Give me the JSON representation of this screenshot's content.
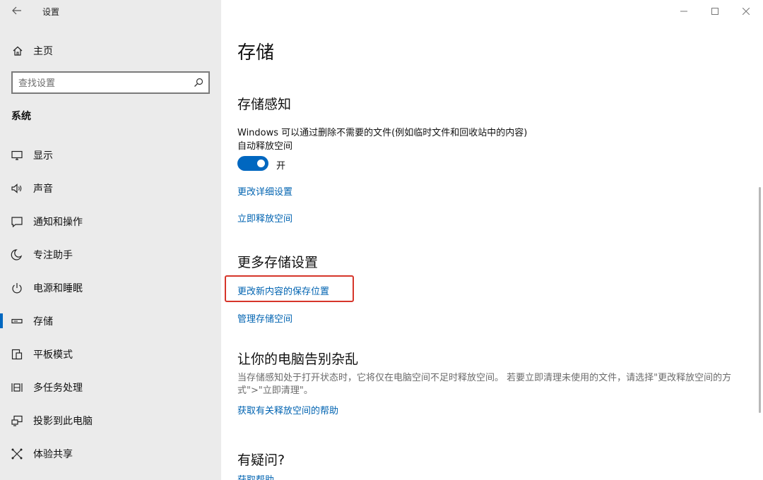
{
  "window": {
    "title": "设置",
    "controls": [
      "minimize-icon",
      "maximize-icon",
      "close-icon"
    ]
  },
  "sidebar": {
    "home_label": "主页",
    "search_placeholder": "查找设置",
    "section_title": "系统",
    "items": [
      {
        "label": "显示",
        "icon": "display-icon"
      },
      {
        "label": "声音",
        "icon": "speaker-icon"
      },
      {
        "label": "通知和操作",
        "icon": "notification-icon"
      },
      {
        "label": "专注助手",
        "icon": "moon-icon"
      },
      {
        "label": "电源和睡眠",
        "icon": "power-icon"
      },
      {
        "label": "存储",
        "icon": "storage-icon",
        "active": true
      },
      {
        "label": "平板模式",
        "icon": "tablet-icon"
      },
      {
        "label": "多任务处理",
        "icon": "multitask-icon"
      },
      {
        "label": "投影到此电脑",
        "icon": "project-icon"
      },
      {
        "label": "体验共享",
        "icon": "share-icon"
      }
    ]
  },
  "main": {
    "title": "存储",
    "storage_sense": {
      "heading": "存储感知",
      "description": "Windows 可以通过删除不需要的文件(例如临时文件和回收站中的内容)",
      "description2": "自动释放空间",
      "toggle_label": "开",
      "toggle_on": true,
      "link_change": "更改详细设置",
      "link_free_now": "立即释放空间"
    },
    "more_settings": {
      "heading": "更多存储设置",
      "link_save_location": "更改新内容的保存位置",
      "link_manage": "管理存储空间"
    },
    "declutter": {
      "heading": "让你的电脑告别杂乱",
      "description": "当存储感知处于打开状态时，它将仅在电脑空间不足时释放空间。 若要立即清理未使用的文件，请选择\"更改释放空间的方式\">\"立即清理\"。",
      "link_help": "获取有关释放空间的帮助"
    },
    "questions": {
      "heading": "有疑问?",
      "link_help": "获取帮助"
    }
  },
  "colors": {
    "accent": "#0067c0",
    "link": "#0063b1",
    "highlight": "#d6352a",
    "sidebar_bg": "#ebebeb"
  }
}
